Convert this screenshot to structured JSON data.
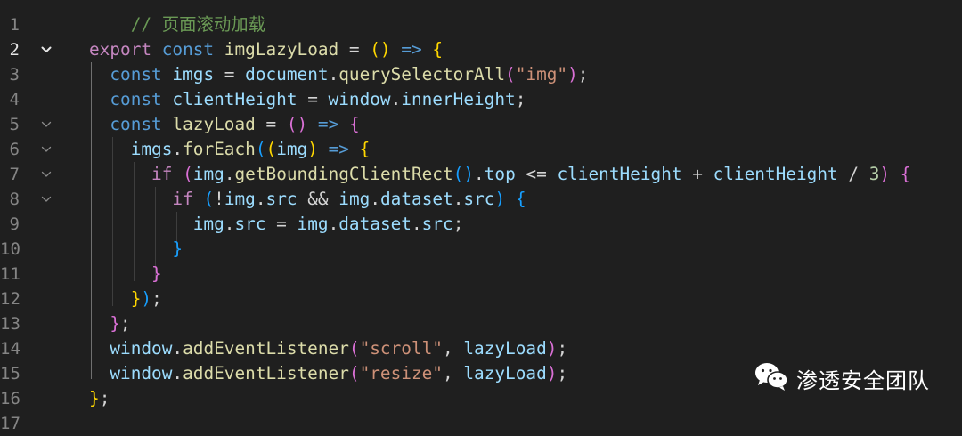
{
  "editor": {
    "active_line": 2,
    "colors": {
      "background": "#1f1f1f",
      "line_number": "#858585",
      "line_number_active": "#e6e6e6",
      "comment": "#6a9955",
      "keyword": "#569cd6",
      "storage": "#c586c0",
      "identifier": "#9cdcfe",
      "function": "#dcdcaa",
      "string": "#ce9178",
      "number": "#b5cea8",
      "operator": "#d4d4d4",
      "bracket_gold": "#ffd700",
      "bracket_purple": "#da70d6",
      "bracket_blue": "#179fff"
    },
    "lines": [
      {
        "n": "1",
        "tokens": [
          {
            "t": "    "
          },
          {
            "t": "// 页面滚动加载",
            "c": "comment"
          }
        ]
      },
      {
        "n": "2",
        "fold": "expanded",
        "tokens": [
          {
            "t": "export",
            "c": "storage"
          },
          {
            "t": " "
          },
          {
            "t": "const",
            "c": "keyword"
          },
          {
            "t": " "
          },
          {
            "t": "imgLazyLoad",
            "c": "function"
          },
          {
            "t": " = ",
            "c": "operator"
          },
          {
            "t": "()",
            "c": "bracket_gold"
          },
          {
            "t": " ",
            "c": "operator"
          },
          {
            "t": "=>",
            "c": "keyword"
          },
          {
            "t": " "
          },
          {
            "t": "{",
            "c": "bracket_gold"
          }
        ]
      },
      {
        "n": "3",
        "tokens": [
          {
            "t": "  "
          },
          {
            "t": "const",
            "c": "keyword"
          },
          {
            "t": " "
          },
          {
            "t": "imgs",
            "c": "identifier"
          },
          {
            "t": " = ",
            "c": "operator"
          },
          {
            "t": "document",
            "c": "identifier"
          },
          {
            "t": "."
          },
          {
            "t": "querySelectorAll",
            "c": "function"
          },
          {
            "t": "(",
            "c": "bracket_purple"
          },
          {
            "t": "\"img\"",
            "c": "string"
          },
          {
            "t": ")",
            "c": "bracket_purple"
          },
          {
            "t": ";"
          }
        ]
      },
      {
        "n": "4",
        "tokens": [
          {
            "t": "  "
          },
          {
            "t": "const",
            "c": "keyword"
          },
          {
            "t": " "
          },
          {
            "t": "clientHeight",
            "c": "identifier"
          },
          {
            "t": " = ",
            "c": "operator"
          },
          {
            "t": "window",
            "c": "identifier"
          },
          {
            "t": "."
          },
          {
            "t": "innerHeight",
            "c": "identifier"
          },
          {
            "t": ";"
          }
        ]
      },
      {
        "n": "5",
        "fold": "collapsed",
        "tokens": [
          {
            "t": "  "
          },
          {
            "t": "const",
            "c": "keyword"
          },
          {
            "t": " "
          },
          {
            "t": "lazyLoad",
            "c": "function"
          },
          {
            "t": " = ",
            "c": "operator"
          },
          {
            "t": "()",
            "c": "bracket_purple"
          },
          {
            "t": " "
          },
          {
            "t": "=>",
            "c": "keyword"
          },
          {
            "t": " "
          },
          {
            "t": "{",
            "c": "bracket_purple"
          }
        ]
      },
      {
        "n": "6",
        "fold": "collapsed",
        "tokens": [
          {
            "t": "    "
          },
          {
            "t": "imgs",
            "c": "identifier"
          },
          {
            "t": "."
          },
          {
            "t": "forEach",
            "c": "function"
          },
          {
            "t": "(",
            "c": "bracket_blue"
          },
          {
            "t": "(",
            "c": "bracket_gold"
          },
          {
            "t": "img",
            "c": "identifier"
          },
          {
            "t": ")",
            "c": "bracket_gold"
          },
          {
            "t": " "
          },
          {
            "t": "=>",
            "c": "keyword"
          },
          {
            "t": " "
          },
          {
            "t": "{",
            "c": "bracket_gold"
          }
        ]
      },
      {
        "n": "7",
        "fold": "collapsed",
        "tokens": [
          {
            "t": "      "
          },
          {
            "t": "if",
            "c": "storage"
          },
          {
            "t": " "
          },
          {
            "t": "(",
            "c": "bracket_purple"
          },
          {
            "t": "img",
            "c": "identifier"
          },
          {
            "t": "."
          },
          {
            "t": "getBoundingClientRect",
            "c": "function"
          },
          {
            "t": "()",
            "c": "bracket_blue"
          },
          {
            "t": "."
          },
          {
            "t": "top",
            "c": "identifier"
          },
          {
            "t": " <= ",
            "c": "operator"
          },
          {
            "t": "clientHeight",
            "c": "identifier"
          },
          {
            "t": " + ",
            "c": "operator"
          },
          {
            "t": "clientHeight",
            "c": "identifier"
          },
          {
            "t": " / ",
            "c": "operator"
          },
          {
            "t": "3",
            "c": "number"
          },
          {
            "t": ")",
            "c": "bracket_purple"
          },
          {
            "t": " "
          },
          {
            "t": "{",
            "c": "bracket_purple"
          }
        ]
      },
      {
        "n": "8",
        "fold": "collapsed",
        "tokens": [
          {
            "t": "        "
          },
          {
            "t": "if",
            "c": "storage"
          },
          {
            "t": " "
          },
          {
            "t": "(",
            "c": "bracket_blue"
          },
          {
            "t": "!",
            "c": "operator"
          },
          {
            "t": "img",
            "c": "identifier"
          },
          {
            "t": "."
          },
          {
            "t": "src",
            "c": "identifier"
          },
          {
            "t": " && ",
            "c": "operator"
          },
          {
            "t": "img",
            "c": "identifier"
          },
          {
            "t": "."
          },
          {
            "t": "dataset",
            "c": "identifier"
          },
          {
            "t": "."
          },
          {
            "t": "src",
            "c": "identifier"
          },
          {
            "t": ")",
            "c": "bracket_blue"
          },
          {
            "t": " "
          },
          {
            "t": "{",
            "c": "bracket_blue"
          }
        ]
      },
      {
        "n": "9",
        "tokens": [
          {
            "t": "          "
          },
          {
            "t": "img",
            "c": "identifier"
          },
          {
            "t": "."
          },
          {
            "t": "src",
            "c": "identifier"
          },
          {
            "t": " = ",
            "c": "operator"
          },
          {
            "t": "img",
            "c": "identifier"
          },
          {
            "t": "."
          },
          {
            "t": "dataset",
            "c": "identifier"
          },
          {
            "t": "."
          },
          {
            "t": "src",
            "c": "identifier"
          },
          {
            "t": ";"
          }
        ]
      },
      {
        "n": "10",
        "tokens": [
          {
            "t": "        "
          },
          {
            "t": "}",
            "c": "bracket_blue"
          }
        ]
      },
      {
        "n": "11",
        "tokens": [
          {
            "t": "      "
          },
          {
            "t": "}",
            "c": "bracket_purple"
          }
        ]
      },
      {
        "n": "12",
        "tokens": [
          {
            "t": "    "
          },
          {
            "t": "}",
            "c": "bracket_gold"
          },
          {
            "t": ")",
            "c": "bracket_blue"
          },
          {
            "t": ";"
          }
        ]
      },
      {
        "n": "13",
        "tokens": [
          {
            "t": "  "
          },
          {
            "t": "}",
            "c": "bracket_purple"
          },
          {
            "t": ";"
          }
        ]
      },
      {
        "n": "14",
        "tokens": [
          {
            "t": "  "
          },
          {
            "t": "window",
            "c": "identifier"
          },
          {
            "t": "."
          },
          {
            "t": "addEventListener",
            "c": "function"
          },
          {
            "t": "(",
            "c": "bracket_purple"
          },
          {
            "t": "\"scroll\"",
            "c": "string"
          },
          {
            "t": ", "
          },
          {
            "t": "lazyLoad",
            "c": "identifier"
          },
          {
            "t": ")",
            "c": "bracket_purple"
          },
          {
            "t": ";"
          }
        ]
      },
      {
        "n": "15",
        "tokens": [
          {
            "t": "  "
          },
          {
            "t": "window",
            "c": "identifier"
          },
          {
            "t": "."
          },
          {
            "t": "addEventListener",
            "c": "function"
          },
          {
            "t": "(",
            "c": "bracket_purple"
          },
          {
            "t": "\"resize\"",
            "c": "string"
          },
          {
            "t": ", "
          },
          {
            "t": "lazyLoad",
            "c": "identifier"
          },
          {
            "t": ")",
            "c": "bracket_purple"
          },
          {
            "t": ";"
          }
        ]
      },
      {
        "n": "16",
        "tokens": [
          {
            "t": "}",
            "c": "bracket_gold"
          },
          {
            "t": ";"
          }
        ]
      },
      {
        "n": "17",
        "tokens": []
      }
    ]
  },
  "watermark": {
    "icon": "wechat-icon",
    "text": "渗透安全团队"
  }
}
